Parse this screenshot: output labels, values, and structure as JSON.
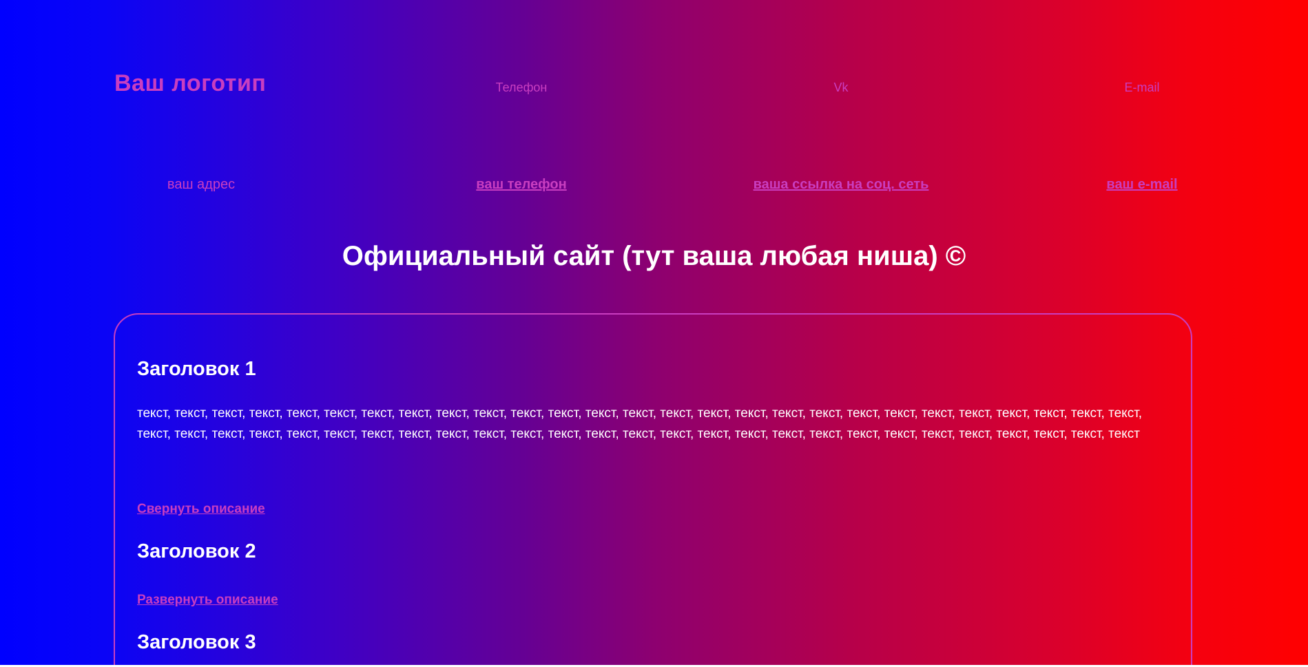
{
  "header": {
    "logo_text": "Ваш логотип",
    "nav": [
      {
        "label": "Телефон"
      },
      {
        "label": "Vk"
      },
      {
        "label": "E-mail"
      }
    ]
  },
  "contacts": {
    "address": "ваш адрес",
    "phone": "ваш телефон",
    "social": "ваша ссылка на соц. сеть",
    "email": "ваш e-mail"
  },
  "main": {
    "title": "Официальный сайт (тут ваша любая ниша) ©"
  },
  "sections": [
    {
      "heading": "Заголовок 1",
      "text": "текст, текст, текст, текст, текст, текст, текст, текст, текст, текст, текст, текст, текст, текст, текст, текст, текст, текст, текст, текст, текст, текст, текст, текст, текст, текст, текст, текст, текст, текст, текст, текст, текст, текст, текст, текст, текст, текст, текст, текст, текст, текст, текст, текст, текст, текст, текст, текст, текст, текст, текст, текст, текст, текст",
      "toggle_label": "Свернуть описание"
    },
    {
      "heading": "Заголовок 2",
      "toggle_label": "Развернуть описание"
    },
    {
      "heading": "Заголовок 3"
    }
  ],
  "colors": {
    "gradient_start": "#0000ff",
    "gradient_end": "#ff0000",
    "accent": "#c93ec0",
    "text": "#ffffff"
  }
}
